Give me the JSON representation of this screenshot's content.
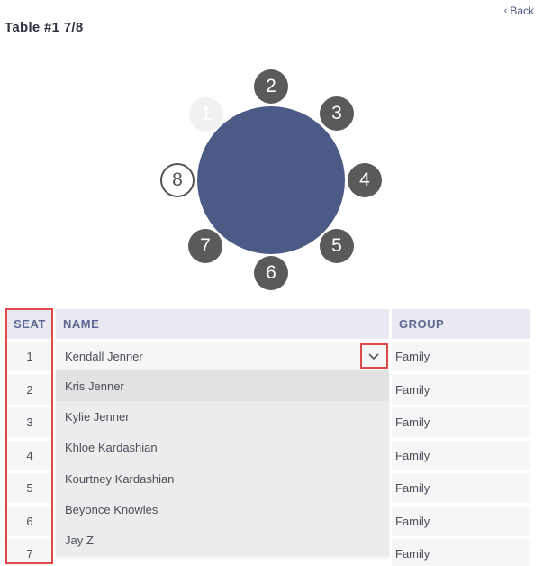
{
  "header": {
    "back_label": "Back",
    "title": "Table #1 7/8"
  },
  "diagram": {
    "seats": [
      {
        "label": "1",
        "state": "empty"
      },
      {
        "label": "2",
        "state": "occupied"
      },
      {
        "label": "3",
        "state": "occupied"
      },
      {
        "label": "4",
        "state": "occupied"
      },
      {
        "label": "5",
        "state": "occupied"
      },
      {
        "label": "6",
        "state": "occupied"
      },
      {
        "label": "7",
        "state": "occupied"
      },
      {
        "label": "8",
        "state": "selected"
      }
    ]
  },
  "grid": {
    "columns": {
      "seat": "SEAT",
      "name": "NAME",
      "group": "GROUP"
    },
    "rows": [
      {
        "seat": "1",
        "name": "Kendall Jenner",
        "group": "Family"
      },
      {
        "seat": "2",
        "group": "Family"
      },
      {
        "seat": "3",
        "group": "Family"
      },
      {
        "seat": "4",
        "group": "Family"
      },
      {
        "seat": "5",
        "group": "Family"
      },
      {
        "seat": "6",
        "group": "Family"
      },
      {
        "seat": "7",
        "group": "Family"
      }
    ],
    "dropdown_options": [
      "Kris Jenner",
      "Kylie Jenner",
      "Khloe Kardashian",
      "Kourtney Kardashian",
      "Beyonce Knowles",
      "Jay Z"
    ]
  },
  "colors": {
    "table": "#4c5b85",
    "seat_occupied": "#5a5a5a",
    "header_bg": "#e9e9f1",
    "highlight": "#e04a4a"
  }
}
